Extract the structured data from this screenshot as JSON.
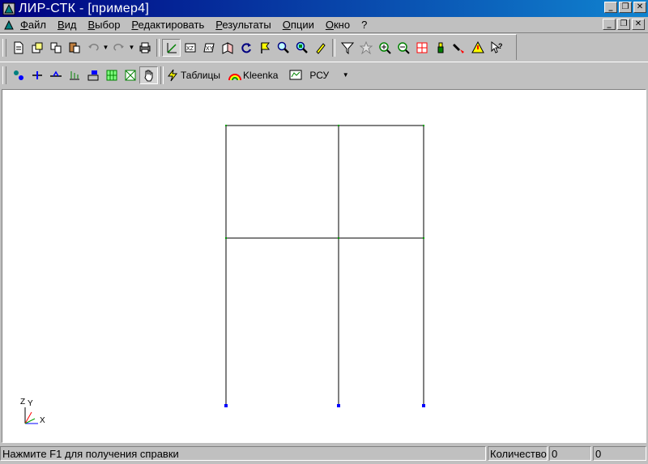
{
  "window": {
    "title": "ЛИР-СТК - [пример4]"
  },
  "menu": {
    "items": [
      "Файл",
      "Вид",
      "Выбор",
      "Редактировать",
      "Результаты",
      "Опции",
      "Окно",
      "?"
    ]
  },
  "toolbar2": {
    "tables_label": "Таблицы",
    "rainbow_label": "Kleenka",
    "rsu_label": "РСУ"
  },
  "status": {
    "hint": "Нажмите F1 для получения справки",
    "count_label": "Количество",
    "count_value": "0",
    "extra_value": "0"
  },
  "axes": {
    "z": "Z",
    "y": "Y",
    "x": "X"
  },
  "colors": {
    "frame": "#000000",
    "link": "#00a000",
    "support": "#0000ff",
    "title_bar": "#000080"
  }
}
